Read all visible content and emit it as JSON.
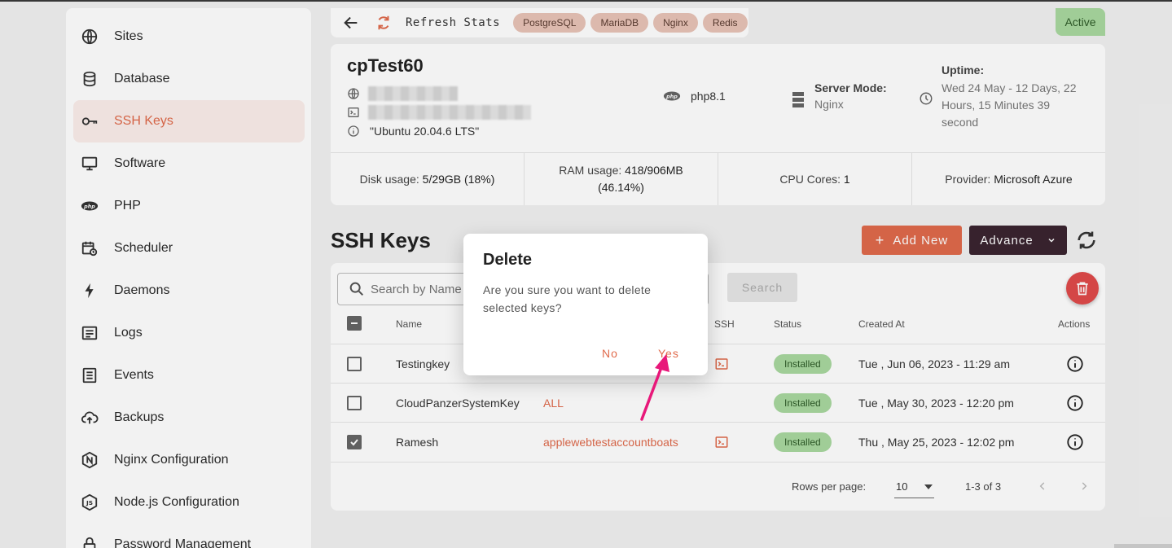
{
  "sidebar": {
    "items": [
      {
        "label": "Sites",
        "icon": "globe-icon"
      },
      {
        "label": "Database",
        "icon": "database-icon"
      },
      {
        "label": "SSH Keys",
        "icon": "key-icon",
        "active": true
      },
      {
        "label": "Software",
        "icon": "monitor-icon"
      },
      {
        "label": "PHP",
        "icon": "php-icon"
      },
      {
        "label": "Scheduler",
        "icon": "calendar-clock-icon"
      },
      {
        "label": "Daemons",
        "icon": "bolt-icon"
      },
      {
        "label": "Logs",
        "icon": "logs-icon"
      },
      {
        "label": "Events",
        "icon": "events-icon"
      },
      {
        "label": "Backups",
        "icon": "cloud-upload-icon"
      },
      {
        "label": "Nginx Configuration",
        "icon": "nginx-icon"
      },
      {
        "label": "Node.js Configuration",
        "icon": "nodejs-icon"
      },
      {
        "label": "Password Management",
        "icon": "lock-icon"
      }
    ]
  },
  "topbar": {
    "refresh_label": "Refresh Stats",
    "chips": [
      "PostgreSQL",
      "MariaDB",
      "Nginx",
      "Redis"
    ],
    "status": "Active"
  },
  "server": {
    "name": "cpTest60",
    "os": "\"Ubuntu 20.04.6 LTS\"",
    "php": "php8.1",
    "mode_label": "Server Mode:",
    "mode_value": "Nginx",
    "uptime_label": "Uptime:",
    "uptime_value": "Wed 24 May - 12 Days, 22 Hours, 15 Minutes 39 second",
    "stats": {
      "disk_label": "Disk usage:",
      "disk_value": "5/29GB (18%)",
      "ram_label": "RAM usage:",
      "ram_value": "418/906MB (46.14%)",
      "cpu_label": "CPU Cores:",
      "cpu_value": "1",
      "provider_label": "Provider:",
      "provider_value": "Microsoft Azure"
    }
  },
  "ssh": {
    "title": "SSH Keys",
    "add_label": "Add New",
    "advance_label": "Advance",
    "search_placeholder": "Search by Name",
    "search_button": "Search",
    "columns": {
      "name": "Name",
      "ssh": "SSH",
      "status": "Status",
      "created": "Created At",
      "actions": "Actions"
    },
    "rows": [
      {
        "name": "Testingkey",
        "user": "",
        "status": "Installed",
        "created": "Tue , Jun 06, 2023 - 11:29 am",
        "checked": false
      },
      {
        "name": "CloudPanzerSystemKey",
        "user": "ALL",
        "status": "Installed",
        "created": "Tue , May 30, 2023 - 12:20 pm",
        "checked": false
      },
      {
        "name": "Ramesh",
        "user": "applewebtestaccountboats",
        "status": "Installed",
        "created": "Thu , May 25, 2023 - 12:02 pm",
        "checked": true
      }
    ],
    "pagination": {
      "rows_per_page_label": "Rows per page:",
      "rows_per_page": "10",
      "range": "1-3 of 3"
    }
  },
  "dialog": {
    "title": "Delete",
    "message": "Are you sure you want to delete selected keys?",
    "no_label": "No",
    "yes_label": "Yes"
  },
  "colors": {
    "accent": "#e06a4b",
    "dark": "#3a2430",
    "success_bg": "#a9d9a0",
    "danger": "#e04a4a",
    "annotation": "#e8187a"
  }
}
